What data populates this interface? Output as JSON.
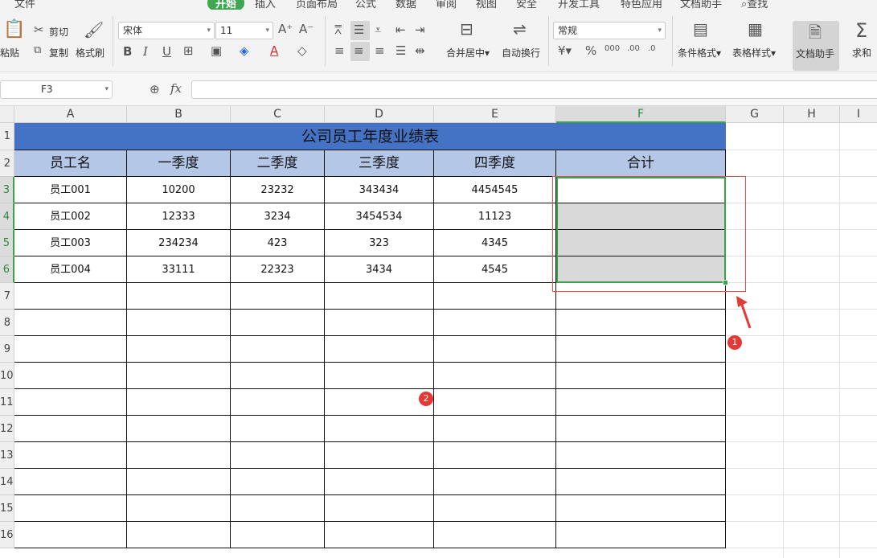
{
  "menu": {
    "items": [
      "文件",
      "开始",
      "插入",
      "页面布局",
      "公式",
      "数据",
      "审阅",
      "视图",
      "安全",
      "开发工具",
      "特色应用",
      "文档助手",
      "查找"
    ],
    "active": "开始"
  },
  "ribbon": {
    "paste": "粘贴",
    "cut": "剪切",
    "copy": "复制",
    "format_painter": "格式刷",
    "font_name": "宋体",
    "font_size": "11",
    "merge_center": "合并居中",
    "wrap_text": "自动换行",
    "number_format": "常规",
    "conditional_format": "条件格式",
    "table_style": "表格样式",
    "doc_assistant": "文档助手",
    "sum": "求和",
    "font_buttons": [
      "B",
      "I",
      "U"
    ],
    "percent": "%"
  },
  "formula_bar": {
    "name_box": "F3",
    "fx_label": "fx",
    "value": ""
  },
  "columns": [
    "A",
    "B",
    "C",
    "D",
    "E",
    "F",
    "G",
    "H",
    "I"
  ],
  "rows": [
    "1",
    "2",
    "3",
    "4",
    "5",
    "6",
    "7",
    "8",
    "9",
    "10",
    "11",
    "12",
    "13",
    "14",
    "15",
    "16"
  ],
  "sheet": {
    "title": "公司员工年度业绩表",
    "headers": [
      "员工名",
      "一季度",
      "二季度",
      "三季度",
      "四季度",
      "合计"
    ],
    "data": [
      [
        "员工001",
        "10200",
        "23232",
        "343434",
        "4454545",
        ""
      ],
      [
        "员工002",
        "12333",
        "3234",
        "3454534",
        "11123",
        ""
      ],
      [
        "员工003",
        "234234",
        "423",
        "323",
        "4345",
        ""
      ],
      [
        "员工004",
        "33111",
        "22323",
        "3434",
        "4545",
        ""
      ]
    ]
  },
  "annotations": {
    "badge1": "1",
    "badge2": "2"
  },
  "colors": {
    "title_fill": "#4472c4",
    "header_fill": "#b4c7e7",
    "selection_border": "#3aa44b",
    "annotation_red": "#e53935"
  }
}
